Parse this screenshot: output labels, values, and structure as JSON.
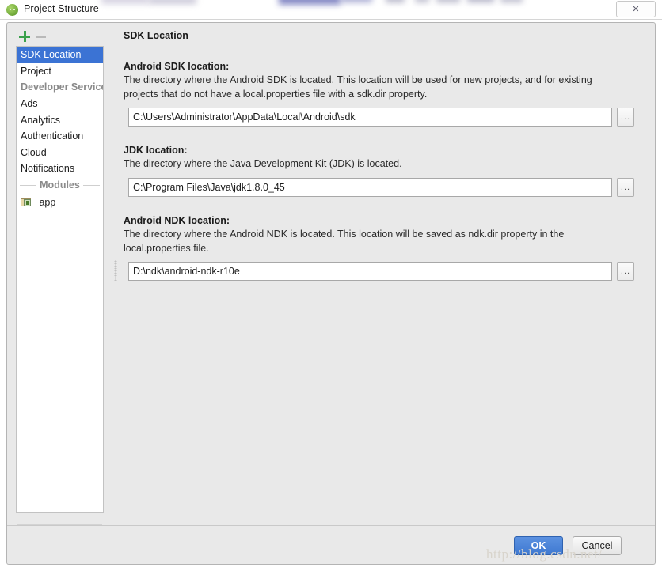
{
  "window": {
    "title": "Project Structure",
    "icon": "android-head-icon",
    "close_label": "✕"
  },
  "sidebar": {
    "toolbar": {
      "add_label": "+",
      "remove_label": "−"
    },
    "items": [
      {
        "label": "SDK Location",
        "type": "item",
        "selected": true
      },
      {
        "label": "Project",
        "type": "item",
        "selected": false
      },
      {
        "label": "Developer Services",
        "type": "group",
        "selected": false
      },
      {
        "label": "Ads",
        "type": "item",
        "selected": false
      },
      {
        "label": "Analytics",
        "type": "item",
        "selected": false
      },
      {
        "label": "Authentication",
        "type": "item",
        "selected": false
      },
      {
        "label": "Cloud",
        "type": "item",
        "selected": false
      },
      {
        "label": "Notifications",
        "type": "item",
        "selected": false
      },
      {
        "label": "Modules",
        "type": "separator",
        "selected": false
      },
      {
        "label": "app",
        "type": "module",
        "selected": false
      }
    ]
  },
  "content": {
    "pane_title": "SDK Location",
    "sections": [
      {
        "label": "Android SDK location:",
        "description": "The directory where the Android SDK is located. This location will be used for new projects, and for existing projects that do not have a local.properties file with a sdk.dir property.",
        "value": "C:\\Users\\Administrator\\AppData\\Local\\Android\\sdk",
        "placeholder": "",
        "browse_label": "..."
      },
      {
        "label": "JDK location:",
        "description": "The directory where the Java Development Kit (JDK) is located.",
        "value": "C:\\Program Files\\Java\\jdk1.8.0_45",
        "placeholder": "",
        "browse_label": "..."
      },
      {
        "label": "Android NDK location:",
        "description": "The directory where the Android NDK is located. This location will be saved as ndk.dir property in the local.properties file.",
        "value": "D:\\ndk\\android-ndk-r10e",
        "placeholder": "",
        "browse_label": "..."
      }
    ]
  },
  "footer": {
    "ok_label": "OK",
    "cancel_label": "Cancel"
  },
  "watermark": {
    "text": "http://blog.csdn.net/"
  },
  "colors": {
    "selection_blue": "#3b73d4",
    "primary_button": "#3f79d1",
    "dialog_background": "#e9e9e9",
    "add_icon_green": "#3aa14b"
  }
}
